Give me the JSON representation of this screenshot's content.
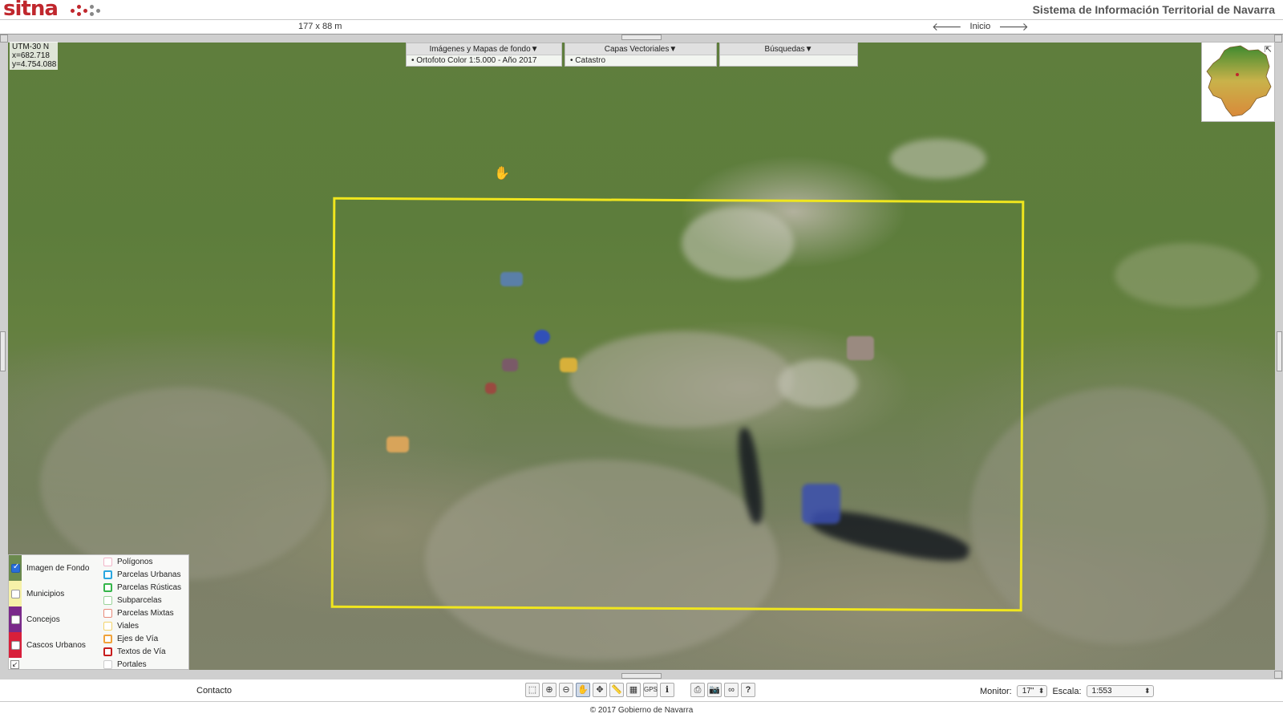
{
  "header": {
    "logo_text": "sitna",
    "site_title": "Sistema de Información Territorial de Navarra"
  },
  "topbar": {
    "extent": "177 x 88 m",
    "nav_back_icon": "arrow-left-icon",
    "nav_home": "Inicio",
    "nav_forward_icon": "arrow-right-icon"
  },
  "map": {
    "coords": {
      "projection": "UTM-30 N",
      "x": "x=682.718",
      "y": "y=4.754.088"
    },
    "selection_color": "#f0e61e"
  },
  "panels": {
    "background": {
      "title": "Imágenes y Mapas de fondo▼",
      "item": "• Ortofoto Color 1:5.000 - Año 2017"
    },
    "vector": {
      "title": "Capas Vectoriales▼",
      "item": "• Catastro"
    },
    "search": {
      "title": "Búsquedas▼"
    }
  },
  "legend": {
    "col1": [
      {
        "label": "Imagen de Fondo",
        "checked": true,
        "color": "#6b8a4e"
      },
      {
        "label": "Municipios",
        "checked": false,
        "color": "#f6f1a8"
      },
      {
        "label": "Concejos",
        "checked": false,
        "color": "#7a2a8a"
      },
      {
        "label": "Cascos Urbanos",
        "checked": false,
        "color": "#d81f3a"
      }
    ],
    "col2": [
      {
        "label": "Polígonos",
        "color": "#f2b5c8"
      },
      {
        "label": "Parcelas Urbanas",
        "color": "#2aa7e0"
      },
      {
        "label": "Parcelas Rústicas",
        "color": "#35b54a"
      },
      {
        "label": "Subparcelas",
        "color": "#9ad49a"
      },
      {
        "label": "Parcelas Mixtas",
        "color": "#e88a7a"
      },
      {
        "label": "Viales",
        "color": "#f3d36a"
      },
      {
        "label": "Ejes de Vía",
        "color": "#f0a23a"
      },
      {
        "label": "Textos de Vía",
        "color": "#c81e1e"
      },
      {
        "label": "Portales",
        "color": "#cccccc"
      }
    ]
  },
  "bottombar": {
    "contact": "Contacto",
    "monitor_label": "Monitor:",
    "monitor_value": "17\"",
    "scale_label": "Escala:",
    "scale_value": "1:553",
    "gps_label": "GPS",
    "help_label": "?"
  },
  "footer": {
    "copyright": "© 2017 Gobierno de Navarra"
  }
}
